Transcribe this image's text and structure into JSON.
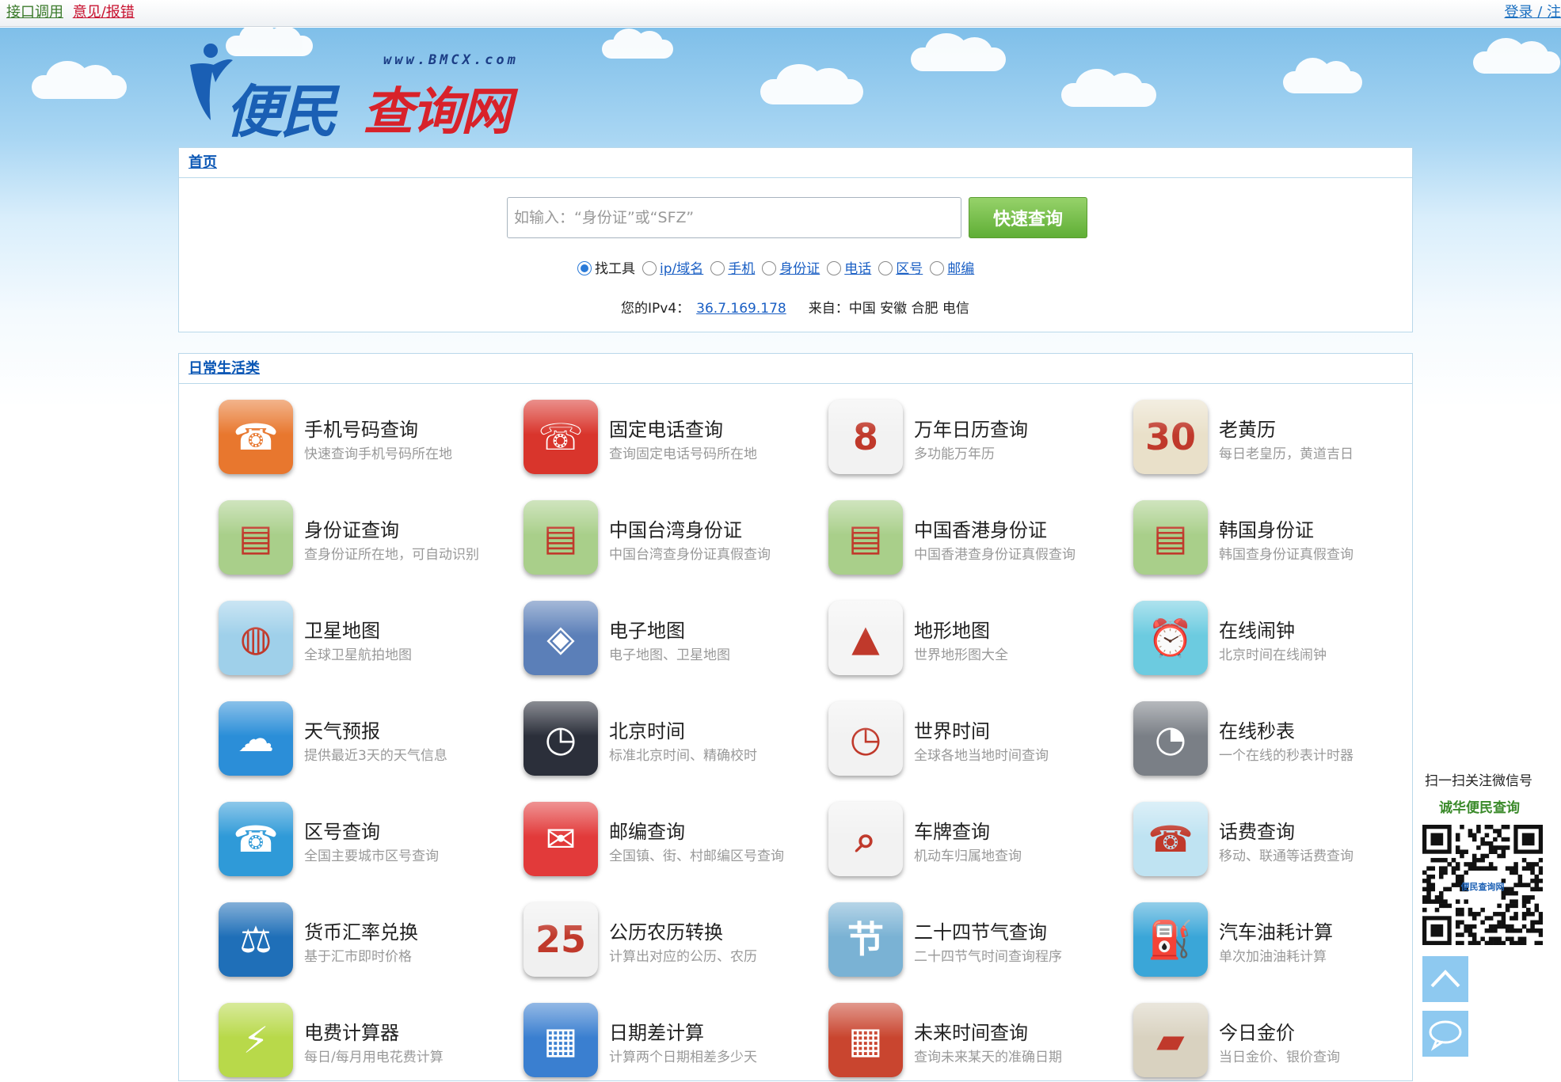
{
  "topbar": {
    "api_link": "接口调用",
    "feedback_link": "意见/报错",
    "login_link": "登录 / 注"
  },
  "logo": {
    "url": "www.BMCX.com",
    "brand_blue": "便民",
    "brand_red": "查询网"
  },
  "search_panel": {
    "breadcrumb": "首页",
    "placeholder": "如输入：“身份证”或“SFZ”",
    "button": "快速查询",
    "radios": [
      {
        "label": "找工具",
        "checked": true,
        "link": false
      },
      {
        "label": "ip/域名",
        "checked": false,
        "link": true
      },
      {
        "label": "手机",
        "checked": false,
        "link": true
      },
      {
        "label": "身份证",
        "checked": false,
        "link": true
      },
      {
        "label": "电话",
        "checked": false,
        "link": true
      },
      {
        "label": "区号",
        "checked": false,
        "link": true
      },
      {
        "label": "邮编",
        "checked": false,
        "link": true
      }
    ],
    "ip_label": "您的IPv4：",
    "ip_value": "36.7.169.178",
    "from_label": "来自：中国 安徽 合肥 电信"
  },
  "tools_panel": {
    "title": "日常生活类",
    "tools": [
      {
        "name": "手机号码查询",
        "desc": "快速查询手机号码所在地",
        "icon": "mobile-phone-icon",
        "color": "#e8772e",
        "glyph": "☎"
      },
      {
        "name": "固定电话查询",
        "desc": "查询固定电话号码所在地",
        "icon": "rotary-phone-icon",
        "color": "#d9352c",
        "glyph": "☏"
      },
      {
        "name": "万年日历查询",
        "desc": "多功能万年历",
        "icon": "calendar-icon",
        "color": "#f2f2f2",
        "glyph": "8"
      },
      {
        "name": "老黄历",
        "desc": "每日老皇历，黄道吉日",
        "icon": "almanac-icon",
        "color": "#e9e0c9",
        "glyph": "30"
      },
      {
        "name": "身份证查询",
        "desc": "查身份证所在地，可自动识别",
        "icon": "id-card-icon",
        "color": "#a9cf8a",
        "glyph": "▤"
      },
      {
        "name": "中国台湾身份证",
        "desc": "中国台湾查身份证真假查询",
        "icon": "taiwan-id-icon",
        "color": "#a9cf8a",
        "glyph": "▤"
      },
      {
        "name": "中国香港身份证",
        "desc": "中国香港查身份证真假查询",
        "icon": "hongkong-id-icon",
        "color": "#a9cf8a",
        "glyph": "▤"
      },
      {
        "name": "韩国身份证",
        "desc": "韩国查身份证真假查询",
        "icon": "korea-id-icon",
        "color": "#a9cf8a",
        "glyph": "▤"
      },
      {
        "name": "卫星地图",
        "desc": "全球卫星航拍地图",
        "icon": "satellite-map-icon",
        "color": "#9fd0ea",
        "glyph": "◍"
      },
      {
        "name": "电子地图",
        "desc": "电子地图、卫星地图",
        "icon": "map-icon",
        "color": "#5b7fb8",
        "glyph": "◈"
      },
      {
        "name": "地形地图",
        "desc": "世界地形图大全",
        "icon": "terrain-map-icon",
        "color": "#f4f4f4",
        "glyph": "▲"
      },
      {
        "name": "在线闹钟",
        "desc": "北京时间在线闹钟",
        "icon": "alarm-clock-icon",
        "color": "#6ccbe0",
        "glyph": "⏰"
      },
      {
        "name": "天气预报",
        "desc": "提供最近3天的天气信息",
        "icon": "weather-icon",
        "color": "#2b8ed8",
        "glyph": "☁"
      },
      {
        "name": "北京时间",
        "desc": "标准北京时间、精确校时",
        "icon": "clock-icon",
        "color": "#2b2f3a",
        "glyph": "◷"
      },
      {
        "name": "世界时间",
        "desc": "全球各地当地时间查询",
        "icon": "world-time-icon",
        "color": "#f2f2f2",
        "glyph": "◷"
      },
      {
        "name": "在线秒表",
        "desc": "一个在线的秒表计时器",
        "icon": "stopwatch-icon",
        "color": "#7a7f86",
        "glyph": "◔"
      },
      {
        "name": "区号查询",
        "desc": "全国主要城市区号查询",
        "icon": "area-code-icon",
        "color": "#2f9ad8",
        "glyph": "☎"
      },
      {
        "name": "邮编查询",
        "desc": "全国镇、街、村邮编区号查询",
        "icon": "postcode-icon",
        "color": "#e23a3a",
        "glyph": "✉"
      },
      {
        "name": "车牌查询",
        "desc": "机动车归属地查询",
        "icon": "license-plate-icon",
        "color": "#f2f2f2",
        "glyph": "⌕"
      },
      {
        "name": "话费查询",
        "desc": "移动、联通等话费查询",
        "icon": "phone-bill-icon",
        "color": "#bfe3f2",
        "glyph": "☎"
      },
      {
        "name": "货币汇率兑换",
        "desc": "基于汇市即时价格",
        "icon": "currency-scale-icon",
        "color": "#1f6fb8",
        "glyph": "⚖"
      },
      {
        "name": "公历农历转换",
        "desc": "计算出对应的公历、农历",
        "icon": "lunar-calendar-icon",
        "color": "#f0f0f0",
        "glyph": "25"
      },
      {
        "name": "二十四节气查询",
        "desc": "二十四节气时间查询程序",
        "icon": "solar-terms-icon",
        "color": "#7ab2d4",
        "glyph": "节"
      },
      {
        "name": "汽车油耗计算",
        "desc": "单次加油油耗计算",
        "icon": "fuel-can-icon",
        "color": "#3aa6d8",
        "glyph": "⛽"
      },
      {
        "name": "电费计算器",
        "desc": "每日/每月用电花费计算",
        "icon": "electricity-icon",
        "color": "#b8d94a",
        "glyph": "⚡"
      },
      {
        "name": "日期差计算",
        "desc": "计算两个日期相差多少天",
        "icon": "date-diff-icon",
        "color": "#3a7fd0",
        "glyph": "▦"
      },
      {
        "name": "未来时间查询",
        "desc": "查询未来某天的准确日期",
        "icon": "future-date-icon",
        "color": "#c9452f",
        "glyph": "▦"
      },
      {
        "name": "今日金价",
        "desc": "当日金价、银价查询",
        "icon": "gold-bar-icon",
        "color": "#d9d2c0",
        "glyph": "▰"
      }
    ]
  },
  "sidebar": {
    "follow_text": "扫一扫关注微信号",
    "wechat_name": "诚华便民查询",
    "qr_label": "便民查询网"
  }
}
